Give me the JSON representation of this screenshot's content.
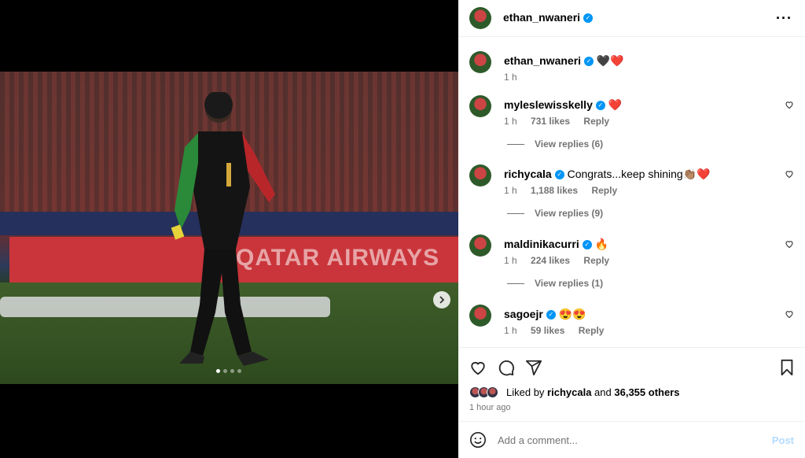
{
  "post": {
    "author": "ethan_nwaneri",
    "caption": "🖤❤️",
    "caption_time": "1 h",
    "media": {
      "banner_text": "QATAR AIRWAYS",
      "carousel_count": 4,
      "carousel_active": 1
    }
  },
  "comments": [
    {
      "user": "myleslewisskelly",
      "text": "❤️",
      "time": "1 h",
      "likes": "731 likes",
      "reply": "Reply",
      "view_replies": "View replies (6)"
    },
    {
      "user": "richycala",
      "text": "Congrats...keep shining👏🏽❤️",
      "time": "1 h",
      "likes": "1,188 likes",
      "reply": "Reply",
      "view_replies": "View replies (9)"
    },
    {
      "user": "maldinikacurri",
      "text": "🔥",
      "time": "1 h",
      "likes": "224 likes",
      "reply": "Reply",
      "view_replies": "View replies (1)"
    },
    {
      "user": "sagoejr",
      "text": "😍😍",
      "time": "1 h",
      "likes": "59 likes",
      "reply": "Reply",
      "view_replies": ""
    }
  ],
  "likes": {
    "prefix": "Liked by",
    "user": "richycala",
    "and": "and",
    "others": "36,355 others"
  },
  "time_ago": "1 hour ago",
  "add_comment": {
    "placeholder": "Add a comment...",
    "post_label": "Post"
  },
  "icons": [
    "more-options-icon",
    "heart-icon",
    "comment-icon",
    "share-icon",
    "bookmark-icon",
    "emoji-icon",
    "chevron-right-icon",
    "verified-icon"
  ]
}
